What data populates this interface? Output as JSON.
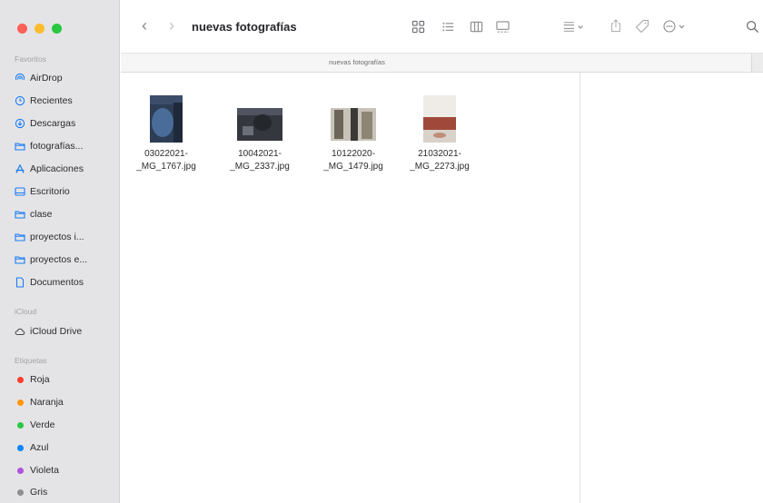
{
  "window": {
    "title": "nuevas fotografías"
  },
  "toolbar": {
    "back_label": "‹",
    "forward_label": "›",
    "title": "nuevas fotografías",
    "path_label": "nuevas fotografías",
    "icons": [
      "icon-view-grid",
      "list-view-icon",
      "column-view-icon",
      "gallery-view-icon",
      "group-by-icon",
      "share-icon",
      "tag-icon",
      "more-actions-icon",
      "search-icon"
    ]
  },
  "sidebar": {
    "favorites_title": "Favoritos",
    "favorites": [
      {
        "label": "AirDrop",
        "icon": "airdrop-icon"
      },
      {
        "label": "Recientes",
        "icon": "clock-icon"
      },
      {
        "label": "Descargas",
        "icon": "download-icon"
      },
      {
        "label": "fotografías...",
        "icon": "folder-icon"
      },
      {
        "label": "Aplicaciones",
        "icon": "apps-icon"
      },
      {
        "label": "Escritorio",
        "icon": "desktop-icon"
      },
      {
        "label": "clase",
        "icon": "folder-icon"
      },
      {
        "label": "proyectos i...",
        "icon": "folder-icon"
      },
      {
        "label": "proyectos e...",
        "icon": "folder-icon"
      },
      {
        "label": "Documentos",
        "icon": "document-icon"
      }
    ],
    "icloud_title": "iCloud",
    "icloud": [
      {
        "label": "iCloud Drive",
        "icon": "cloud-icon"
      }
    ],
    "tags_title": "Etiquetas",
    "tags": [
      {
        "label": "Roja",
        "color": "#ff3b30"
      },
      {
        "label": "Naranja",
        "color": "#ff9500"
      },
      {
        "label": "Verde",
        "color": "#28c840"
      },
      {
        "label": "Azul",
        "color": "#0a84ff"
      },
      {
        "label": "Violeta",
        "color": "#af52de"
      },
      {
        "label": "Gris",
        "color": "#8e8e93"
      }
    ]
  },
  "files": [
    {
      "line1": "03022021-",
      "line2": "_MG_1767.jpg"
    },
    {
      "line1": "10042021-",
      "line2": "_MG_2337.jpg"
    },
    {
      "line1": "10122020-",
      "line2": "_MG_1479.jpg"
    },
    {
      "line1": "21032021-",
      "line2": "_MG_2273.jpg"
    }
  ],
  "colors": {
    "traffic_red": "#fe5f57",
    "traffic_yellow": "#febc2e",
    "traffic_green": "#28c840",
    "accent": "#0a84ff"
  }
}
